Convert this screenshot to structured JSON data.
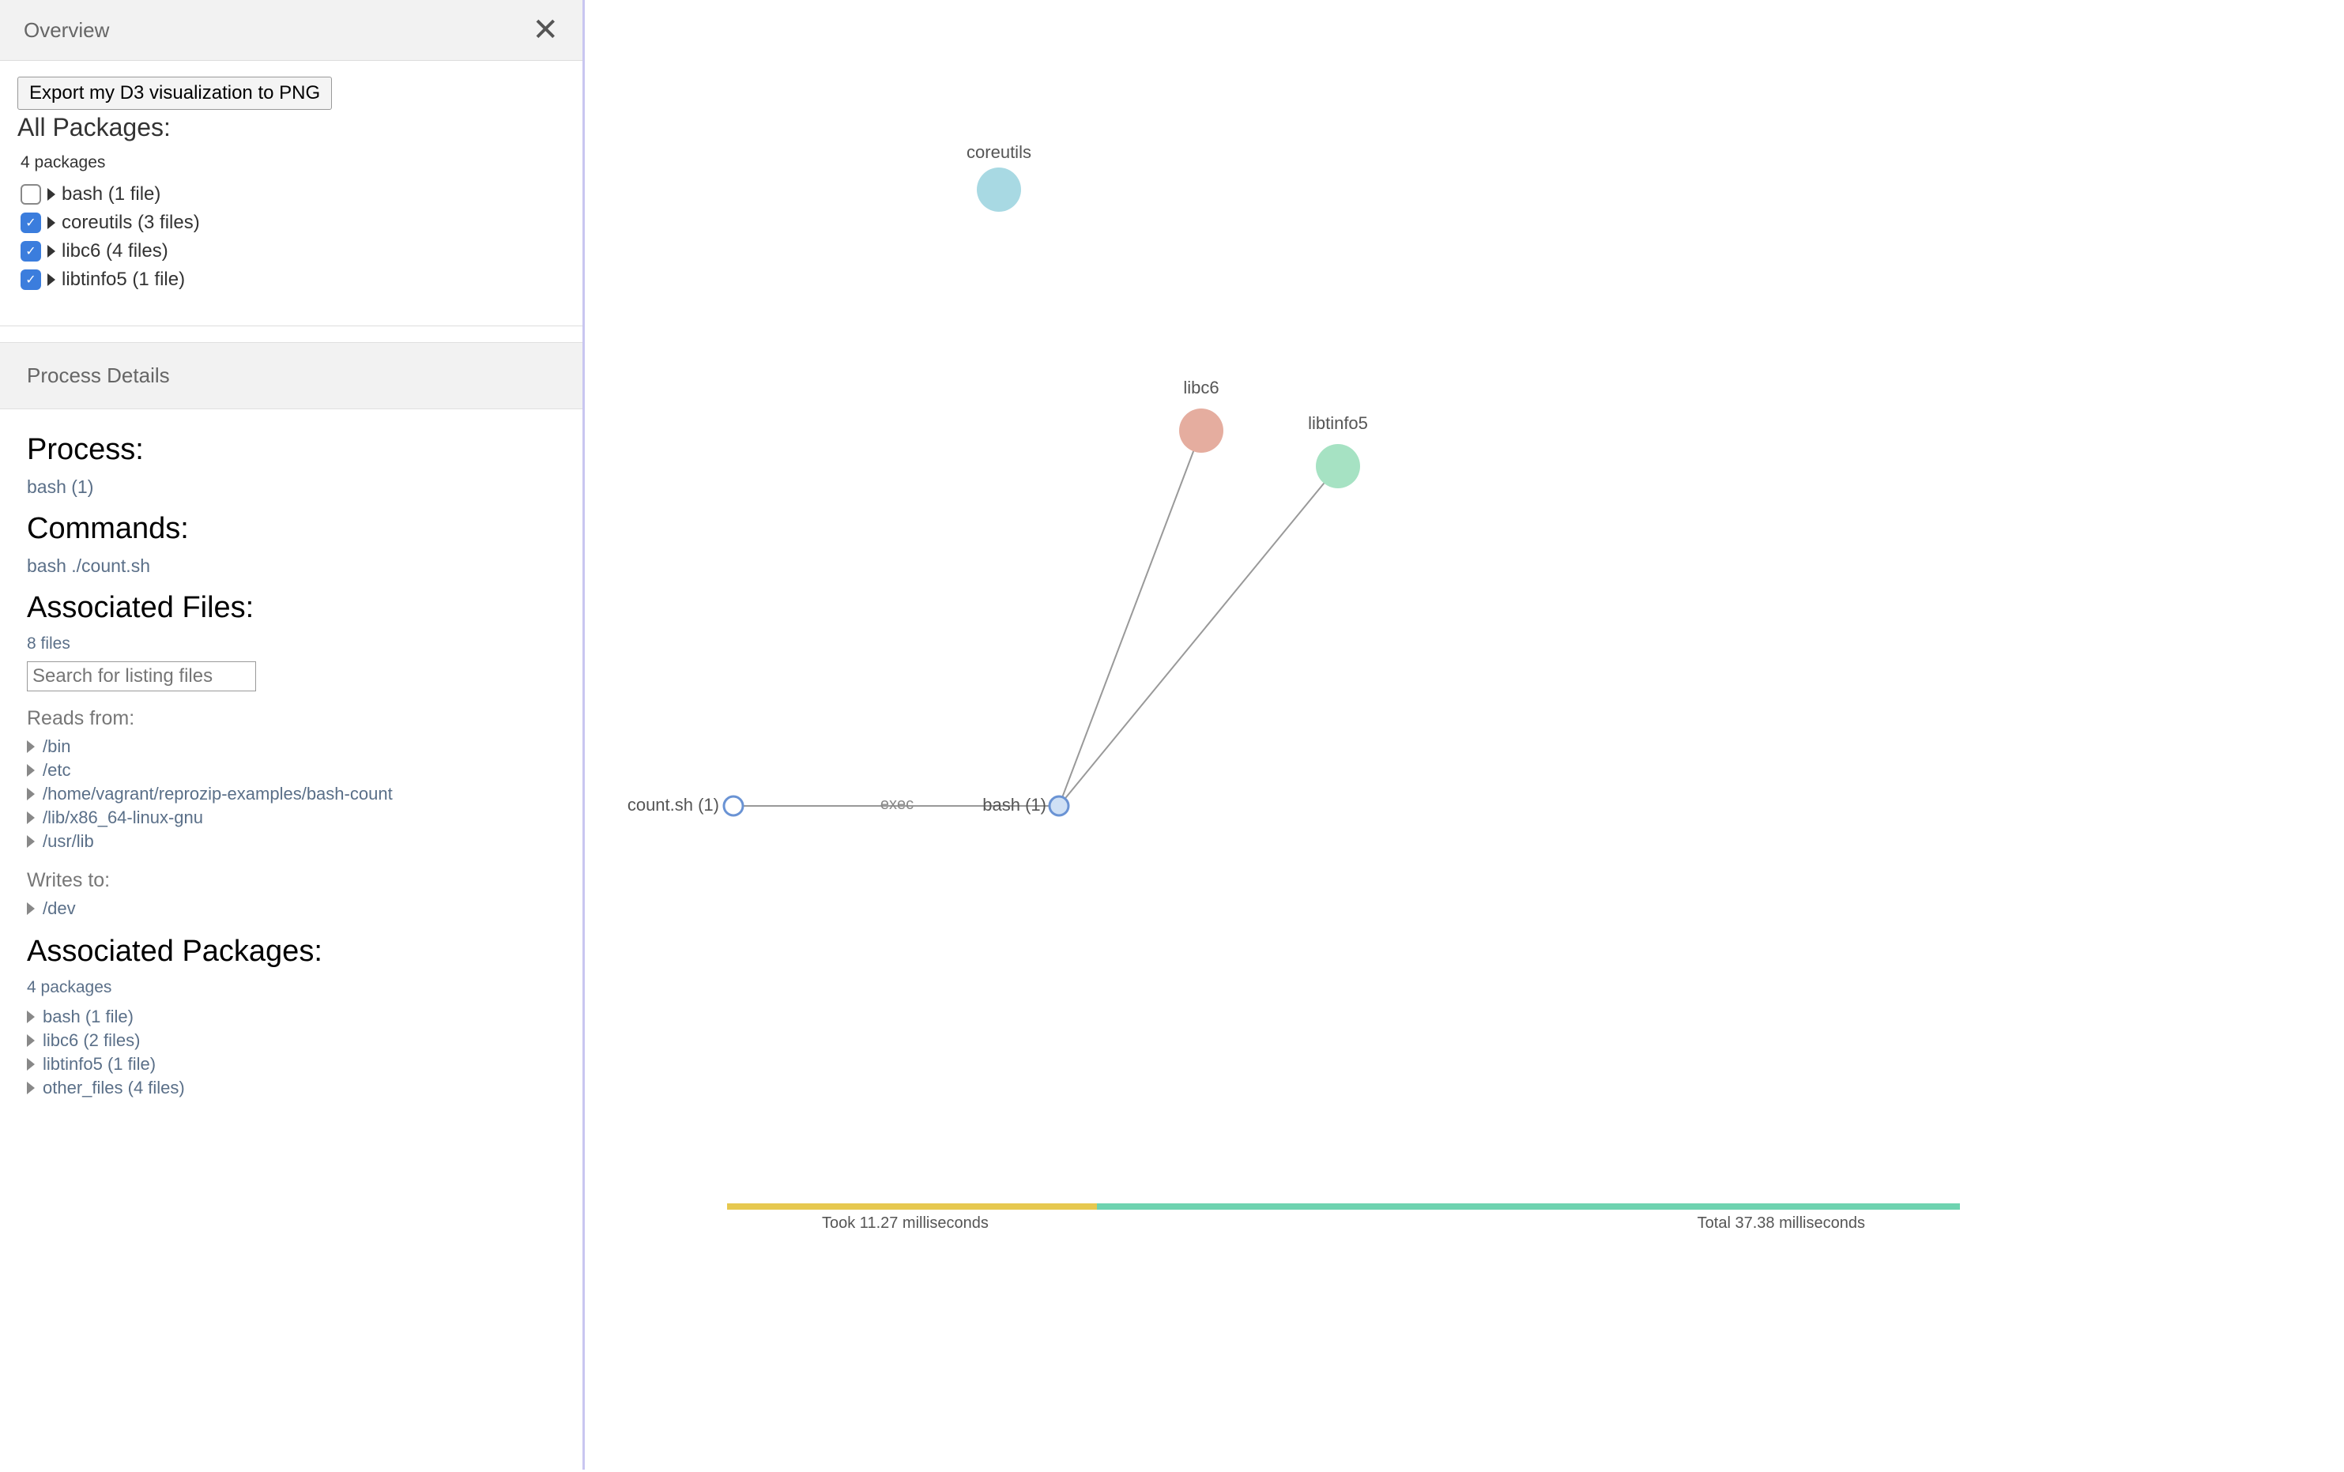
{
  "overview": {
    "title": "Overview",
    "export_btn_label": "Export my D3 visualization to PNG",
    "all_packages_heading": "All Packages:",
    "packages_count": "4 packages",
    "packages": [
      {
        "label": "bash (1 file)",
        "checked": false
      },
      {
        "label": "coreutils (3 files)",
        "checked": true
      },
      {
        "label": "libc6 (4 files)",
        "checked": true
      },
      {
        "label": "libtinfo5 (1 file)",
        "checked": true
      }
    ]
  },
  "details": {
    "title": "Process Details",
    "process_heading": "Process:",
    "process_value": "bash (1)",
    "commands_heading": "Commands:",
    "command_value": "bash ./count.sh",
    "files_heading": "Associated Files:",
    "files_count": "8 files",
    "search_placeholder": "Search for listing files",
    "reads_label": "Reads from:",
    "reads": [
      "/bin",
      "/etc",
      "/home/vagrant/reprozip-examples/bash-count",
      "/lib/x86_64-linux-gnu",
      "/usr/lib"
    ],
    "writes_label": "Writes to:",
    "writes": [
      "/dev"
    ],
    "assoc_pkgs_heading": "Associated Packages:",
    "assoc_pkgs_count": "4 packages",
    "assoc_pkgs": [
      "bash (1 file)",
      "libc6 (2 files)",
      "libtinfo5 (1 file)",
      "other_files (4 files)"
    ]
  },
  "graph": {
    "nodes": {
      "coreutils": {
        "label": "coreutils",
        "color": "#a8d9e3"
      },
      "libc6": {
        "label": "libc6",
        "color": "#e5ad9f"
      },
      "libtinfo5": {
        "label": "libtinfo5",
        "color": "#a6e2c3"
      },
      "count": {
        "label": "count.sh (1)"
      },
      "bash": {
        "label": "bash (1)"
      }
    },
    "edge_label": "exec"
  },
  "timeline": {
    "took_label": "Took 11.27 milliseconds",
    "total_label": "Total 37.38 milliseconds",
    "yellow_fraction": 0.3
  }
}
